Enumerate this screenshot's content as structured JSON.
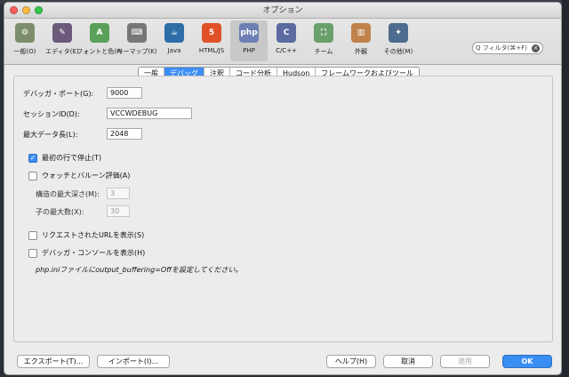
{
  "window": {
    "title": "オプション"
  },
  "toolbar": {
    "items": [
      {
        "label": "一般(O)",
        "icon": "general-settings-icon",
        "color": "#7d8f6a",
        "glyph": "⚙"
      },
      {
        "label": "エディタ(E)",
        "icon": "editor-icon",
        "color": "#6b5a7a",
        "glyph": "✎"
      },
      {
        "label": "フォントと色(F)",
        "icon": "fonts-colors-icon",
        "color": "#5aa05a",
        "glyph": "A"
      },
      {
        "label": "キーマップ(K)",
        "icon": "keymap-icon",
        "color": "#777777",
        "glyph": "⌨"
      },
      {
        "label": "Java",
        "icon": "java-icon",
        "color": "#2d6ea8",
        "glyph": "☕"
      },
      {
        "label": "HTML/JS",
        "icon": "html5-icon",
        "color": "#e0512a",
        "glyph": "5"
      },
      {
        "label": "PHP",
        "icon": "php-icon",
        "color": "#6e7fb5",
        "glyph": "php"
      },
      {
        "label": "C/C++",
        "icon": "cpp-icon",
        "color": "#5b6aa0",
        "glyph": "C"
      },
      {
        "label": "チーム",
        "icon": "team-icon",
        "color": "#6aa06a",
        "glyph": "⛶"
      },
      {
        "label": "外観",
        "icon": "appearance-icon",
        "color": "#c0824a",
        "glyph": "▥"
      },
      {
        "label": "その他(M)",
        "icon": "misc-icon",
        "color": "#4d6c8f",
        "glyph": "✦"
      }
    ],
    "selected_index": 6
  },
  "search": {
    "placeholder": "Q フィルタ(⌘+F)"
  },
  "tabs": [
    "一般",
    "デバッグ",
    "注釈",
    "コード分析",
    "Hudson",
    "フレームワークおよびツール"
  ],
  "active_tab": 1,
  "settings": {
    "debugger_port_label": "デバッガ・ポート(G):",
    "debugger_port_value": "9000",
    "session_id_label": "セッションID(D):",
    "session_id_value": "VCCWDEBUG",
    "max_data_label": "最大データ長(L):",
    "max_data_value": "2048",
    "stop_first_line_label": "最初の行で停止(T)",
    "stop_first_line_checked": true,
    "watch_balloon_label": "ウォッチとバルーン評価(A)",
    "watch_balloon_checked": false,
    "max_depth_label": "構造の最大深さ(M):",
    "max_depth_value": "3",
    "max_children_label": "子の最大数(X):",
    "max_children_value": "30",
    "show_request_url_label": "リクエストされたURLを表示(S)",
    "show_request_url_checked": false,
    "show_debugger_console_label": "デバッガ・コンソールを表示(H)",
    "show_debugger_console_checked": false,
    "note_text": "php.iniファイルにoutput_buffering=Offを設定してください。"
  },
  "buttons": {
    "export": "エクスポート(T)...",
    "import": "インポート(I)...",
    "help": "ヘルプ(H)",
    "cancel": "取消",
    "apply": "適用",
    "ok": "OK"
  }
}
